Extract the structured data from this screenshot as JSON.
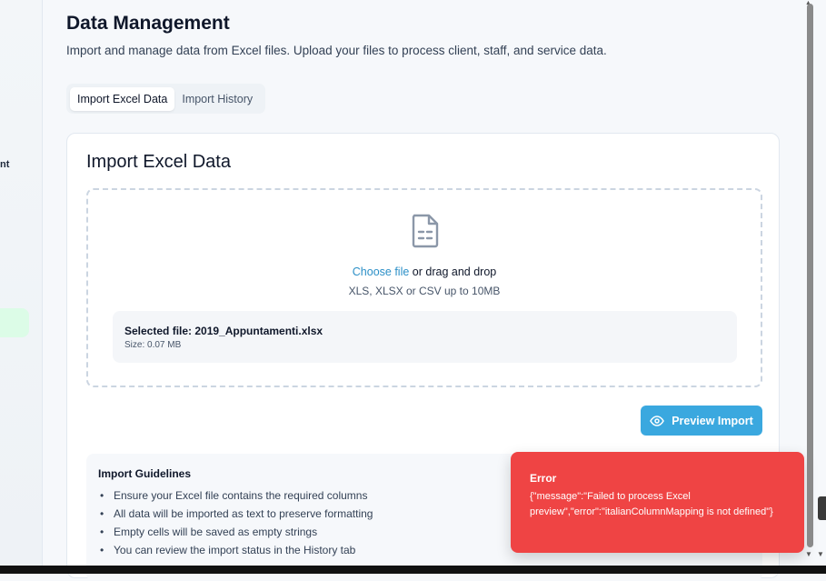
{
  "sidebar": {
    "fragment_text": "nt"
  },
  "page": {
    "title": "Data Management",
    "subtitle": "Import and manage data from Excel files. Upload your files to process client, staff, and service data."
  },
  "tabs": [
    {
      "label": "Import Excel Data",
      "active": true
    },
    {
      "label": "Import History",
      "active": false
    }
  ],
  "card": {
    "title": "Import Excel Data",
    "dropzone": {
      "icon": "file-spreadsheet-icon",
      "choose_label": "Choose file",
      "drag_text": "or drag and drop",
      "hint": "XLS, XLSX or CSV up to 10MB"
    },
    "selected_file": {
      "label": "Selected file: 2019_Appuntamenti.xlsx",
      "size": "Size: 0.07 MB"
    },
    "preview_button": {
      "label": "Preview Import",
      "icon": "eye-icon"
    },
    "guidelines": {
      "title": "Import Guidelines",
      "items": [
        "Ensure your Excel file contains the required columns",
        "All data will be imported as text to preserve formatting",
        "Empty cells will be saved as empty strings",
        "You can review the import status in the History tab"
      ]
    }
  },
  "toast": {
    "title": "Error",
    "message": "{\"message\":\"Failed to process Excel preview\",\"error\":\"italianColumnMapping is not defined\"}"
  },
  "colors": {
    "accent": "#3aa8df",
    "link": "#2b8fc7",
    "error": "#ef4444"
  }
}
